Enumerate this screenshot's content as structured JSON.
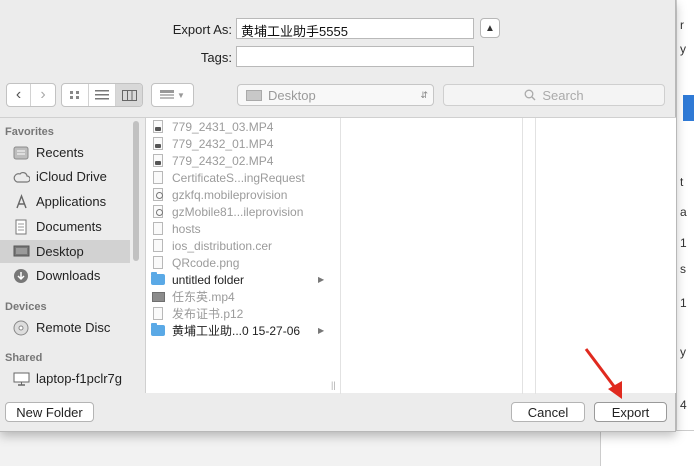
{
  "export": {
    "export_as_label": "Export As:",
    "filename": "黄埔工业助手5555",
    "tags_label": "Tags:",
    "tags_value": ""
  },
  "toolbar": {
    "location": "Desktop",
    "search_placeholder": "Search"
  },
  "sidebar": {
    "favorites_header": "Favorites",
    "favorites": [
      {
        "label": "Recents",
        "icon": "clock-icon"
      },
      {
        "label": "iCloud Drive",
        "icon": "cloud-icon"
      },
      {
        "label": "Applications",
        "icon": "applications-icon"
      },
      {
        "label": "Documents",
        "icon": "documents-icon"
      },
      {
        "label": "Desktop",
        "icon": "desktop-icon",
        "selected": true
      },
      {
        "label": "Downloads",
        "icon": "downloads-icon"
      }
    ],
    "devices_header": "Devices",
    "devices": [
      {
        "label": "Remote Disc",
        "icon": "disc-icon"
      }
    ],
    "shared_header": "Shared",
    "shared": [
      {
        "label": "laptop-f1pclr7g",
        "icon": "computer-icon"
      }
    ]
  },
  "files": [
    {
      "name": "779_2431_03.MP4",
      "type": "mp4",
      "enabled": false
    },
    {
      "name": "779_2432_01.MP4",
      "type": "mp4",
      "enabled": false
    },
    {
      "name": "779_2432_02.MP4",
      "type": "mp4",
      "enabled": false
    },
    {
      "name": "CertificateS...ingRequest",
      "type": "doc",
      "enabled": false
    },
    {
      "name": "gzkfq.mobileprovision",
      "type": "cert",
      "enabled": false
    },
    {
      "name": "gzMobile81...ileprovision",
      "type": "cert",
      "enabled": false
    },
    {
      "name": "hosts",
      "type": "doc",
      "enabled": false
    },
    {
      "name": "ios_distribution.cer",
      "type": "doc",
      "enabled": false
    },
    {
      "name": "QRcode.png",
      "type": "doc",
      "enabled": false
    },
    {
      "name": "untitled folder",
      "type": "folder",
      "enabled": true
    },
    {
      "name": "任东英.mp4",
      "type": "video",
      "enabled": false
    },
    {
      "name": "发布证书.p12",
      "type": "doc",
      "enabled": false
    },
    {
      "name": "黄埔工业助...0 15-27-06",
      "type": "folder",
      "enabled": true
    }
  ],
  "footer": {
    "new_folder": "New Folder",
    "cancel": "Cancel",
    "export": "Export"
  },
  "background": {
    "fragments": [
      "r",
      "y",
      "t",
      "a",
      "1",
      "s",
      "1",
      "y",
      "4"
    ]
  },
  "colors": {
    "folder": "#5aa9e6",
    "selection": "#d2d2d2",
    "annotation_arrow": "#e02a1f"
  }
}
